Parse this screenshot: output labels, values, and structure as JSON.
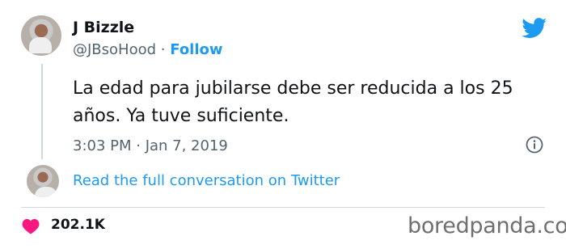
{
  "tweet": {
    "display_name": "J Bizzle",
    "handle": "@JBsoHood",
    "separator": "·",
    "follow_label": "Follow",
    "text": "La edad para jubilarse debe ser reducida a los 25 años. Ya tuve suficiente.",
    "timestamp": "3:03 PM · Jan 7, 2019",
    "read_conversation": "Read the full conversation on Twitter",
    "likes": "202.1K"
  },
  "watermark": "boredpanda.com",
  "icons": {
    "brand": "twitter-bird-icon",
    "info": "info-icon",
    "like": "heart-icon"
  },
  "colors": {
    "accent": "#1d9bf0",
    "heart": "#f91880",
    "text": "#0f1419",
    "secondary": "#536471"
  }
}
